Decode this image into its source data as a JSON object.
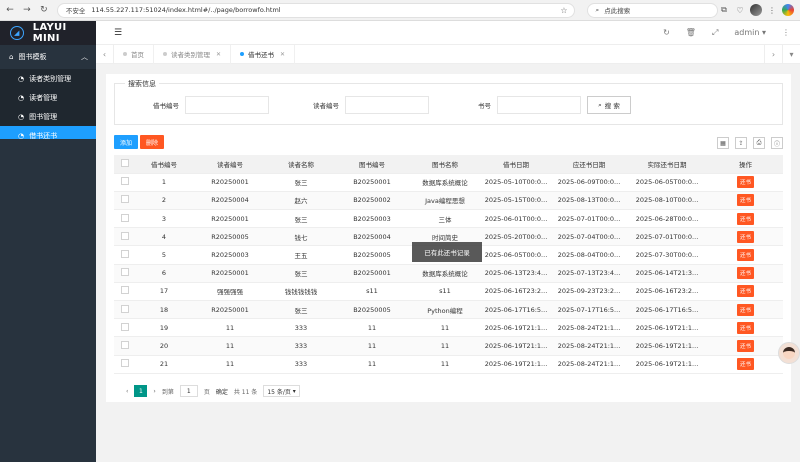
{
  "browser": {
    "insecure_label": "不安全",
    "url": "114.55.227.117:51024/index.html#/../page/borrowfo.html",
    "search_placeholder": "点此搜索"
  },
  "sidebar": {
    "logo": "LAYUI MINI",
    "group_label": "图书模板",
    "items": [
      {
        "label": "读者类别管理"
      },
      {
        "label": "读者管理"
      },
      {
        "label": "图书管理"
      },
      {
        "label": "借书还书"
      }
    ]
  },
  "topbar": {
    "user": "admin"
  },
  "tabs": [
    {
      "label": "首页"
    },
    {
      "label": "读者类别管理"
    },
    {
      "label": "借书还书"
    }
  ],
  "search": {
    "legend": "搜索信息",
    "fields": [
      {
        "label": "借书编号"
      },
      {
        "label": "读者编号"
      },
      {
        "label": "书号"
      }
    ],
    "button": "搜 索"
  },
  "toolbar": {
    "add": "添加",
    "delete": "删除"
  },
  "table": {
    "columns": [
      "借书编号",
      "读者编号",
      "读者名称",
      "图书编号",
      "图书名称",
      "借书日期",
      "应还书日期",
      "实际还书日期",
      "操作"
    ],
    "rows": [
      [
        "1",
        "R20250001",
        "张三",
        "B20250001",
        "数据库系统概论",
        "2025-05-10T00:0...",
        "2025-06-09T00:0...",
        "2025-06-05T00:0...",
        "还书"
      ],
      [
        "2",
        "R20250004",
        "赵六",
        "B20250002",
        "Java编程思想",
        "2025-05-15T00:0...",
        "2025-08-13T00:0...",
        "2025-08-10T00:0...",
        "还书"
      ],
      [
        "3",
        "R20250001",
        "张三",
        "B20250003",
        "三体",
        "2025-06-01T00:0...",
        "2025-07-01T00:0...",
        "2025-06-28T00:0...",
        "还书"
      ],
      [
        "4",
        "R20250005",
        "钱七",
        "B20250004",
        "时间简史",
        "2025-05-20T00:0...",
        "2025-07-04T00:0...",
        "2025-07-01T00:0...",
        "还书"
      ],
      [
        "5",
        "R20250003",
        "王五",
        "B20250005",
        "",
        "2025-06-05T00:0...",
        "2025-08-04T00:0...",
        "2025-07-30T00:0...",
        "还书"
      ],
      [
        "6",
        "R20250001",
        "张三",
        "B20250001",
        "数据库系统概论",
        "2025-06-13T23:4...",
        "2025-07-13T23:4...",
        "2025-06-14T21:3...",
        "还书"
      ],
      [
        "17",
        "强强强强",
        "钱钱钱钱钱",
        "s11",
        "s11",
        "2025-06-16T23:2...",
        "2025-09-23T23:2...",
        "2025-06-16T23:2...",
        "还书"
      ],
      [
        "18",
        "R20250001",
        "张三",
        "B20250005",
        "Python编程",
        "2025-06-17T16:5...",
        "2025-07-17T16:5...",
        "2025-06-17T16:5...",
        "还书"
      ],
      [
        "19",
        "11",
        "333",
        "11",
        "11",
        "2025-06-19T21:1...",
        "2025-08-24T21:1...",
        "2025-06-19T21:1...",
        "还书"
      ],
      [
        "20",
        "11",
        "333",
        "11",
        "11",
        "2025-06-19T21:1...",
        "2025-08-24T21:1...",
        "2025-06-19T21:1...",
        "还书"
      ],
      [
        "21",
        "11",
        "333",
        "11",
        "11",
        "2025-06-19T21:1...",
        "2025-08-24T21:1...",
        "2025-06-19T21:1...",
        "还书"
      ]
    ]
  },
  "pager": {
    "current": "1",
    "goto_label": "到第",
    "page_value": "1",
    "page_suffix": "页",
    "confirm": "确定",
    "total": "共 11 条",
    "per_page": "15 条/页"
  },
  "toast": "已有此还书记录",
  "colors": {
    "primary": "#1e9fff",
    "danger": "#ff5722",
    "pager_active": "#009688",
    "sidebar": "#28333e"
  }
}
